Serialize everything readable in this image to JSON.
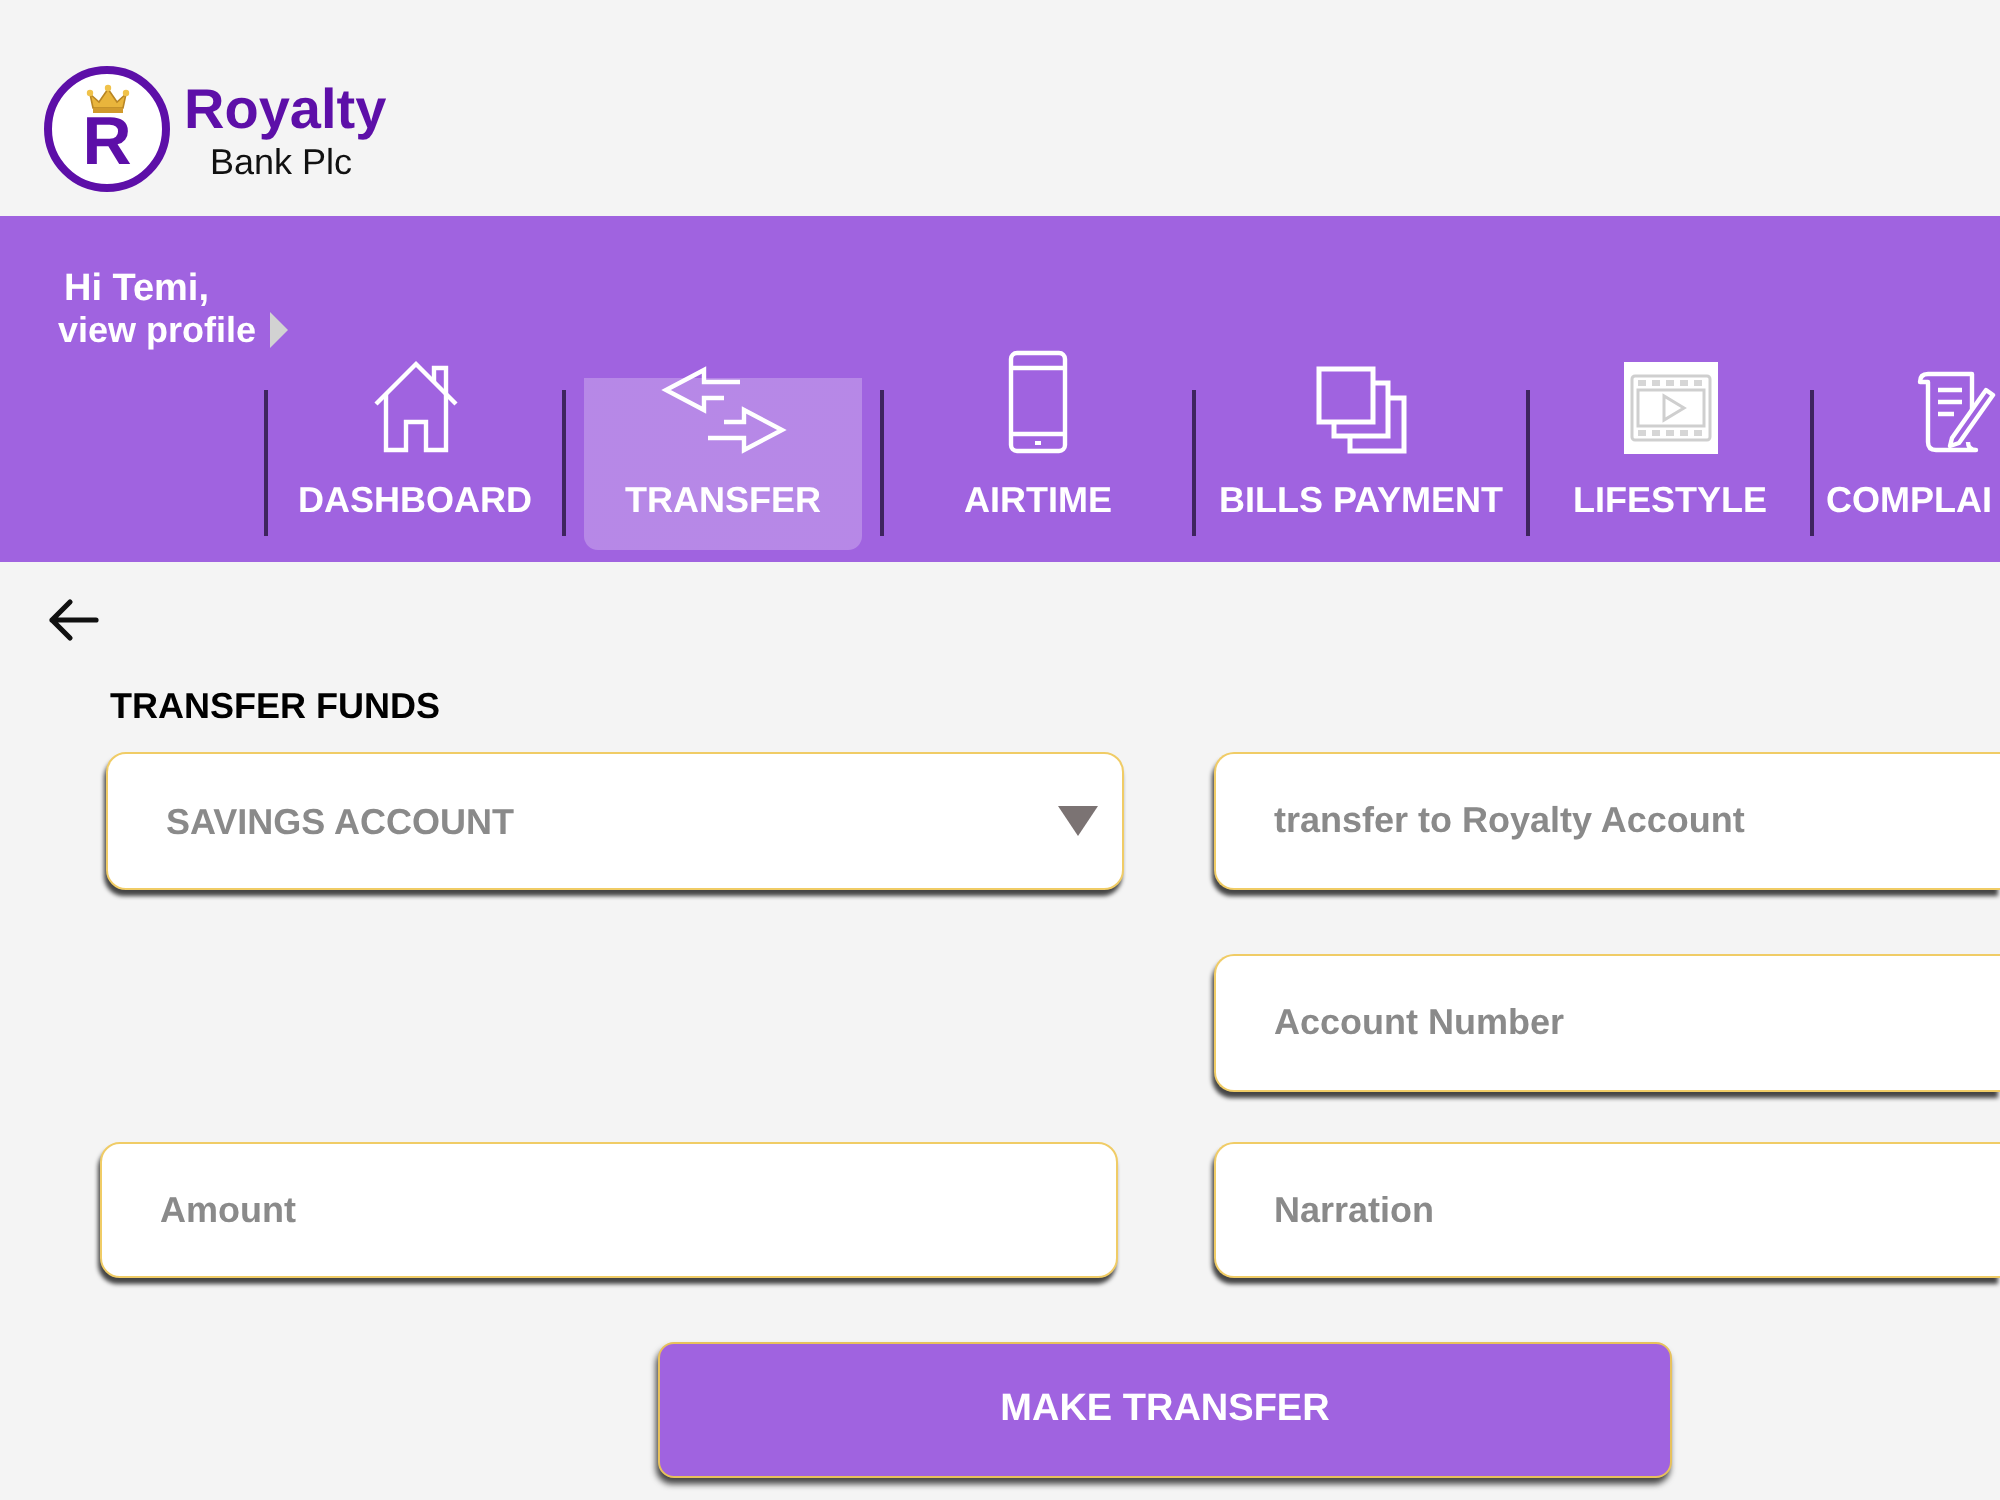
{
  "logo": {
    "letter": "R",
    "name": "Royalty",
    "subtitle": "Bank Plc"
  },
  "nav": {
    "greeting": "Hi Temi,",
    "profile_link": "view profile",
    "tabs": [
      {
        "label": "DASHBOARD",
        "selected": false
      },
      {
        "label": "TRANSFER",
        "selected": true
      },
      {
        "label": "AIRTIME",
        "selected": false
      },
      {
        "label": "BILLS PAYMENT",
        "selected": false
      },
      {
        "label": "LIFESTYLE",
        "selected": false
      },
      {
        "label": "COMPLAI",
        "selected": false
      }
    ]
  },
  "form": {
    "title": "TRANSFER FUNDS",
    "source_account": {
      "value": "SAVINGS ACCOUNT"
    },
    "transfer_type": {
      "placeholder": "transfer to Royalty Account"
    },
    "account_number": {
      "placeholder": "Account Number"
    },
    "amount": {
      "placeholder": "Amount"
    },
    "narration": {
      "placeholder": "Narration"
    },
    "submit": "MAKE TRANSFER"
  }
}
